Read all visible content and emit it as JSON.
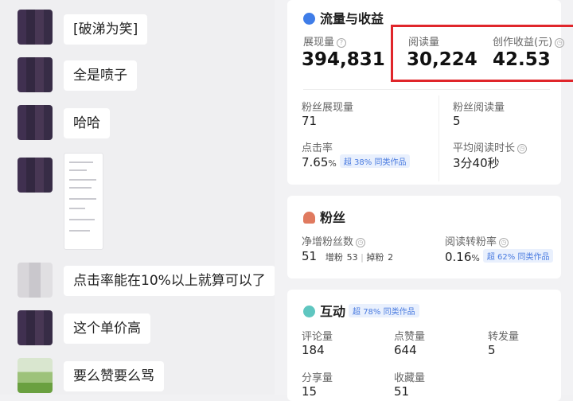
{
  "chat": {
    "messages": [
      {
        "text": "[破涕为笑]"
      },
      {
        "text": "全是喷子"
      },
      {
        "text": "哈哈"
      },
      {
        "text": "点击率能在10%以上就算可以了"
      },
      {
        "text": "这个单价高"
      },
      {
        "text": "要么赞要么骂"
      }
    ]
  },
  "traffic": {
    "title": "流量与收益",
    "impressions_label": "展现量",
    "impressions": "394,831",
    "reads_label": "阅读量",
    "reads": "30,224",
    "revenue_label": "创作收益(元)",
    "revenue": "42.53",
    "fan_impr_label": "粉丝展现量",
    "fan_impr": "71",
    "fan_reads_label": "粉丝阅读量",
    "fan_reads": "5",
    "ctr_label": "点击率",
    "ctr_value": "7.65",
    "ctr_unit": "%",
    "ctr_badge": "超 38% 同类作品",
    "avg_time_label": "平均阅读时长",
    "avg_time": "3分40秒"
  },
  "fans": {
    "title": "粉丝",
    "net_label": "净增粉丝数",
    "net": "51",
    "gain_label": "增粉",
    "gain": "53",
    "loss_label": "掉粉",
    "loss": "2",
    "conv_label": "阅读转粉率",
    "conv_value": "0.16",
    "conv_unit": "%",
    "conv_badge": "超 62% 同类作品"
  },
  "interaction": {
    "title": "互动",
    "badge": "超 78% 同类作品",
    "comments_label": "评论量",
    "comments": "184",
    "likes_label": "点赞量",
    "likes": "644",
    "shares_label": "转发量",
    "shares": "5",
    "share_label": "分享量",
    "share": "15",
    "fav_label": "收藏量",
    "fav": "51"
  },
  "colors": {
    "highlight": "#e0262b",
    "accent": "#4a7be0"
  }
}
